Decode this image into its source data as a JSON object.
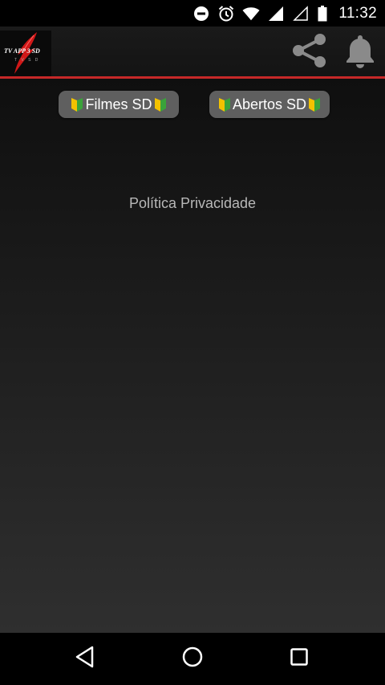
{
  "status_bar": {
    "time": "11:32",
    "icons": [
      "do-not-disturb-icon",
      "alarm-icon",
      "wifi-icon",
      "signal-icon",
      "signal-empty-icon",
      "battery-icon"
    ]
  },
  "app_bar": {
    "logo_text": "TV APP 3 SD",
    "logo_subtext": "T V  S D",
    "actions": [
      "share-icon",
      "bell-icon"
    ],
    "accent_color": "#c62828"
  },
  "buttons": {
    "filmes_label": "Filmes SD",
    "abertos_label": "Abertos SD"
  },
  "privacy_link": "Política Privacidade",
  "nav_bar": {
    "buttons": [
      "back-icon",
      "home-icon",
      "recents-icon"
    ]
  }
}
